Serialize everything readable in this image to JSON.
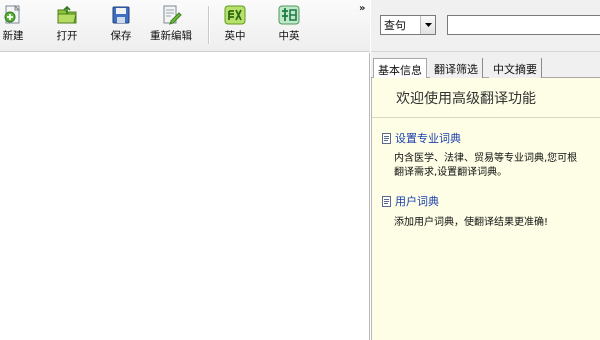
{
  "toolbar": {
    "buttons": [
      {
        "label": "新建",
        "icon": "new-file-icon"
      },
      {
        "label": "打开",
        "icon": "open-folder-icon"
      },
      {
        "label": "保存",
        "icon": "save-disk-icon"
      },
      {
        "label": "重新编辑",
        "icon": "edit-document-icon"
      },
      {
        "label": "英中",
        "icon": "translate-en-zh-icon"
      },
      {
        "label": "中英",
        "icon": "translate-zh-en-icon"
      }
    ],
    "overflow": "»"
  },
  "search": {
    "mode": "查句",
    "query": ""
  },
  "tabs": [
    {
      "label": "基本信息",
      "active": true
    },
    {
      "label": "翻译筛选",
      "active": false
    },
    {
      "label": "中文摘要",
      "active": false
    }
  ],
  "panel": {
    "welcome": "欢迎使用高级翻译功能",
    "sections": [
      {
        "title": "设置专业词典",
        "body": [
          "内含医学、法律、贸易等专业词典,您可根",
          "翻译需求,设置翻译词典。"
        ]
      },
      {
        "title": "用户词典",
        "body": [
          "添加用户词典，使翻译结果更准确!"
        ]
      }
    ]
  },
  "colors": {
    "panel_background": "#fefee6",
    "link_blue": "#1a3fae"
  }
}
